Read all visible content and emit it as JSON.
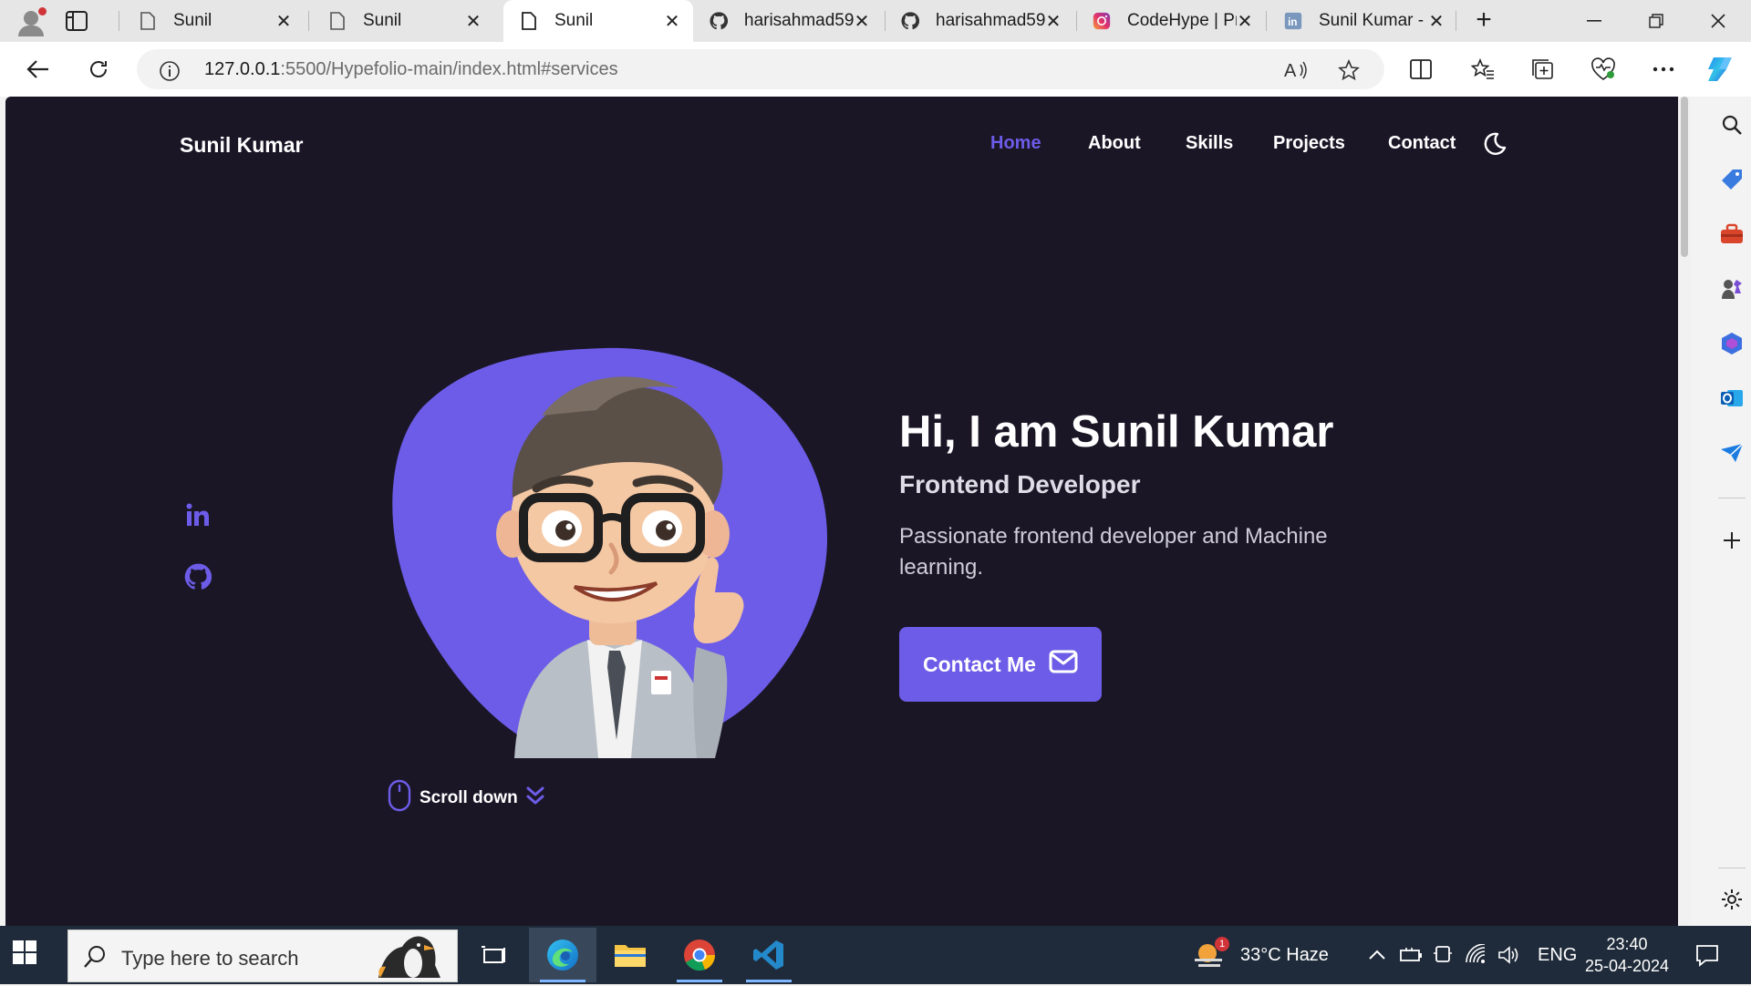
{
  "browser": {
    "tabs": [
      {
        "title": "Sunil",
        "icon": "page-icon",
        "active": false
      },
      {
        "title": "Sunil",
        "icon": "page-icon",
        "active": false
      },
      {
        "title": "Sunil",
        "icon": "page-icon",
        "active": true
      },
      {
        "title": "harisahmad59",
        "icon": "github-icon",
        "active": false
      },
      {
        "title": "harisahmad59",
        "icon": "github-icon",
        "active": false
      },
      {
        "title": "CodeHype | Pr",
        "icon": "instagram-icon",
        "active": false
      },
      {
        "title": "Sunil Kumar -",
        "icon": "linkedin-icon",
        "active": false
      }
    ],
    "url_host": "127.0.0.1",
    "url_rest": ":5500/Hypefolio-main/index.html#services"
  },
  "site": {
    "logo": "Sunil Kumar",
    "nav": [
      "Home",
      "About",
      "Skills",
      "Projects",
      "Contact"
    ],
    "active_nav": "Home",
    "accent": "#6c5ce7",
    "background": "#1a1626",
    "hero": {
      "title": "Hi, I am Sunil Kumar",
      "subtitle": "Frontend Developer",
      "description": "Passionate frontend developer and Machine learning.",
      "cta": "Contact Me"
    },
    "scroll_label": "Scroll down",
    "socials": [
      "linkedin-icon",
      "github-icon"
    ]
  },
  "taskbar": {
    "search_placeholder": "Type here to search",
    "weather": "33°C  Haze",
    "weather_badge": "1",
    "language": "ENG",
    "time": "23:40",
    "date": "25-04-2024"
  }
}
